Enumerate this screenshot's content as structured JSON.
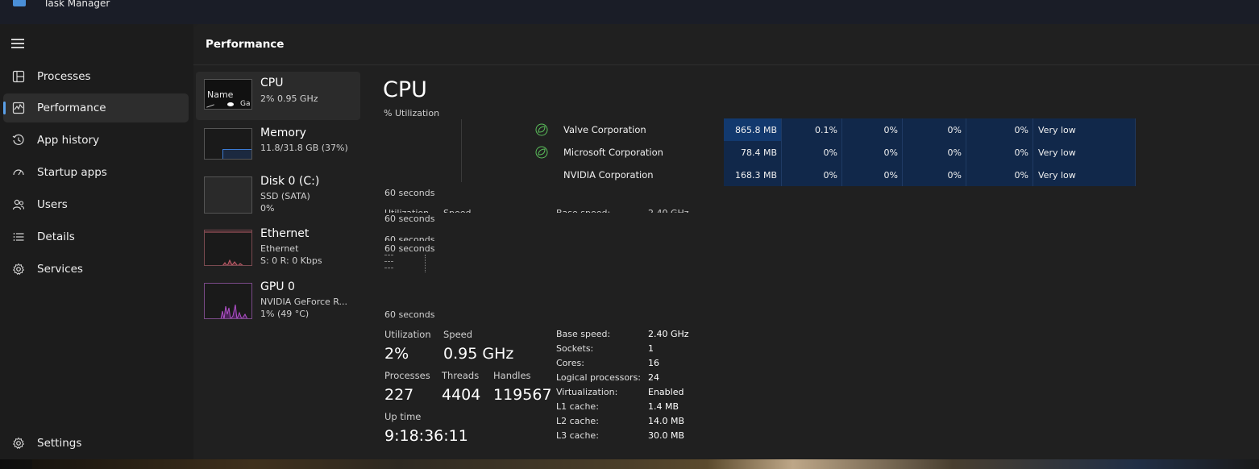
{
  "window": {
    "title": "Task Manager"
  },
  "nav": {
    "items": [
      {
        "label": "Processes",
        "icon": "processes-grid-icon"
      },
      {
        "label": "Performance",
        "icon": "performance-chart-icon",
        "active": true
      },
      {
        "label": "App history",
        "icon": "history-clock-icon"
      },
      {
        "label": "Startup apps",
        "icon": "startup-speedometer-icon"
      },
      {
        "label": "Users",
        "icon": "users-icon"
      },
      {
        "label": "Details",
        "icon": "details-list-icon"
      },
      {
        "label": "Services",
        "icon": "services-gear-icon"
      }
    ],
    "settings_label": "Settings"
  },
  "page": {
    "title": "Performance"
  },
  "resources": {
    "cpu": {
      "name": "CPU",
      "line1": "2%  0.95 GHz",
      "thumb_name": "Name",
      "thumb_ga": "Ga"
    },
    "memory": {
      "name": "Memory",
      "line1": "11.8/31.8 GB (37%)",
      "used_fraction": 0.37
    },
    "disk": {
      "name": "Disk 0 (C:)",
      "line1": "SSD (SATA)",
      "line2": "0%"
    },
    "ethernet": {
      "name": "Ethernet",
      "line1": "Ethernet",
      "line2": "S: 0  R: 0 Kbps"
    },
    "gpu": {
      "name": "GPU 0",
      "line1": "NVIDIA GeForce R...",
      "line2": "1%  (49 °C)"
    }
  },
  "cpu_detail": {
    "title": "CPU",
    "subtitle": "% Utilization",
    "axis_label": "60 seconds",
    "ghost_overlap": {
      "utilization": "Utilization",
      "speed": "Speed",
      "base_speed": "Base speed:",
      "base_speed_value": "2.40 GHz"
    },
    "stats": {
      "utilization_label": "Utilization",
      "utilization_value": "2%",
      "speed_label": "Speed",
      "speed_value": "0.95 GHz",
      "processes_label": "Processes",
      "processes_value": "227",
      "threads_label": "Threads",
      "threads_value": "4404",
      "handles_label": "Handles",
      "handles_value": "119567",
      "uptime_label": "Up time",
      "uptime_value": "9:18:36:11"
    },
    "specs": [
      {
        "key": "Base speed:",
        "value": "2.40 GHz"
      },
      {
        "key": "Sockets:",
        "value": "1"
      },
      {
        "key": "Cores:",
        "value": "16"
      },
      {
        "key": "Logical processors:",
        "value": "24"
      },
      {
        "key": "Virtualization:",
        "value": "Enabled"
      },
      {
        "key": "L1 cache:",
        "value": "1.4 MB"
      },
      {
        "key": "L2 cache:",
        "value": "14.0 MB"
      },
      {
        "key": "L3 cache:",
        "value": "30.0 MB"
      }
    ]
  },
  "process_overlay": {
    "rows": [
      {
        "name": "Valve Corporation",
        "memory": "865.8 MB",
        "cpu": "0.1%",
        "disk": "0%",
        "network": "0%",
        "gpu": "0%",
        "power": "Very low",
        "eco": true
      },
      {
        "name": "Microsoft Corporation",
        "memory": "78.4 MB",
        "cpu": "0%",
        "disk": "0%",
        "network": "0%",
        "gpu": "0%",
        "power": "Very low",
        "eco": true
      },
      {
        "name": "NVIDIA Corporation",
        "memory": "168.3 MB",
        "cpu": "0%",
        "disk": "0%",
        "network": "0%",
        "gpu": "0%",
        "power": "Very low",
        "eco": false
      }
    ]
  },
  "colors": {
    "accent": "#5aa0e8",
    "memory_graph": "#3b7bd4",
    "ethernet_graph": "#c0606c",
    "gpu_graph": "#b050c8",
    "eco_leaf": "#5bbf5b"
  }
}
